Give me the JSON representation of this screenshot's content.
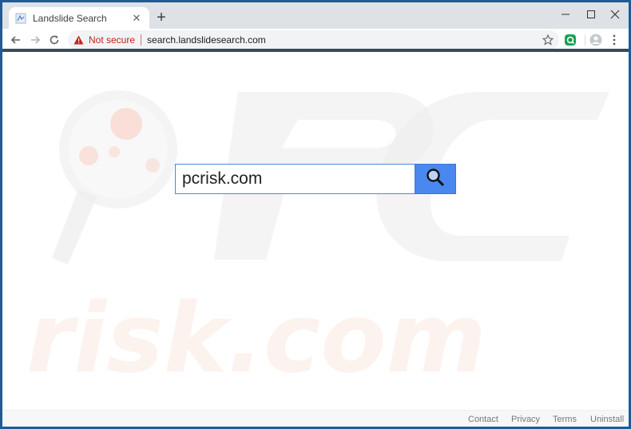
{
  "browser": {
    "tab": {
      "title": "Landslide Search",
      "favicon": "landslide-favicon-icon"
    },
    "new_tab_label": "+",
    "window_controls": [
      "minimize-icon",
      "maximize-icon",
      "close-icon"
    ],
    "address_bar": {
      "security_label": "Not secure",
      "url": "search.landslidesearch.com"
    },
    "accent": "#1d5c96"
  },
  "page": {
    "search": {
      "value": "pcrisk.com",
      "button_icon": "magnifier-icon",
      "button_color": "#4a87ee"
    },
    "footer": {
      "links": [
        "Contact",
        "Privacy",
        "Terms",
        "Uninstall"
      ]
    }
  }
}
